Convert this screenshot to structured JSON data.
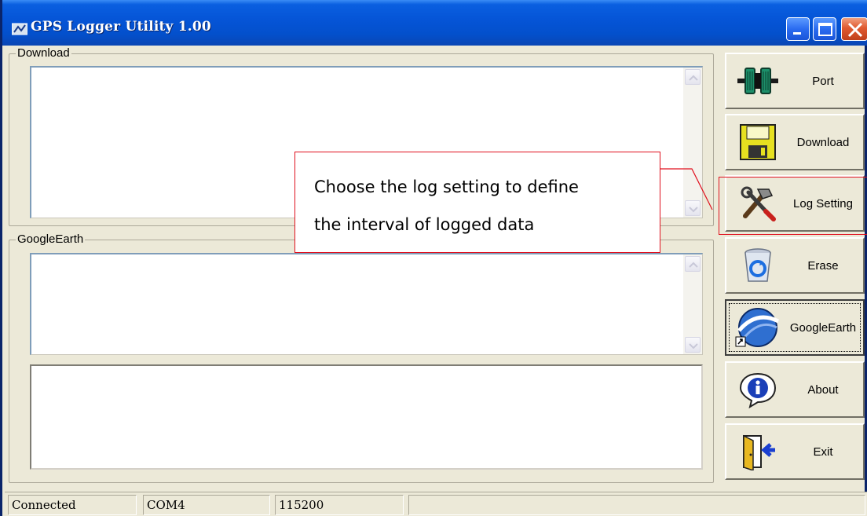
{
  "window": {
    "title": "GPS Logger Utility 1.00"
  },
  "groups": {
    "download_label": "Download",
    "googleearth_label": "GoogleEarth"
  },
  "buttons": {
    "port": "Port",
    "download": "Download",
    "log_setting": "Log Setting",
    "erase": "Erase",
    "googleearth": "GoogleEarth",
    "about": "About",
    "exit": "Exit"
  },
  "callout": {
    "line1": "Choose the log setting to define",
    "line2": "the interval of logged data"
  },
  "status": {
    "connection": "Connected",
    "port": "COM4",
    "baud": "115200"
  },
  "colors": {
    "titlebar": "#0554d6",
    "callout_border": "#e0101e",
    "window_bg": "#ece9d8"
  }
}
